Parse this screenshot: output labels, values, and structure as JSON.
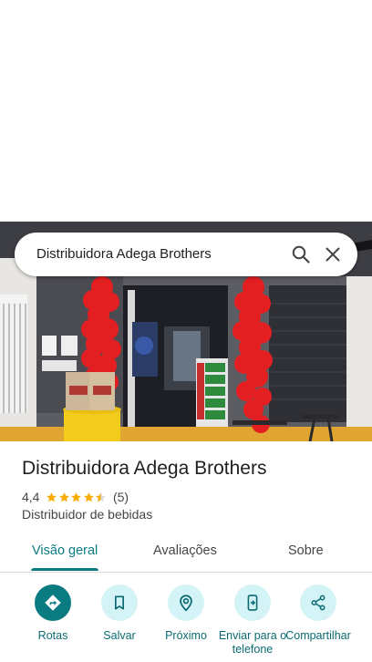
{
  "search": {
    "query": "Distribuidora Adega Brothers"
  },
  "place": {
    "name": "Distribuidora Adega Brothers",
    "rating": "4,4",
    "stars": 4.4,
    "review_count": "(5)",
    "category": "Distribuidor de bebidas"
  },
  "tabs": [
    {
      "label": "Visão geral",
      "active": true
    },
    {
      "label": "Avaliações",
      "active": false
    },
    {
      "label": "Sobre",
      "active": false
    }
  ],
  "actions": [
    {
      "label": "Rotas",
      "icon": "directions-icon"
    },
    {
      "label": "Salvar",
      "icon": "bookmark-icon"
    },
    {
      "label": "Próximo",
      "icon": "nearby-icon"
    },
    {
      "label": "Enviar para o telefone",
      "icon": "send-to-phone-icon"
    },
    {
      "label": "Compartilhar",
      "icon": "share-icon"
    }
  ],
  "colors": {
    "accent": "#0b7b82",
    "star": "#f9ab00",
    "chip": "#d4f3f6"
  }
}
